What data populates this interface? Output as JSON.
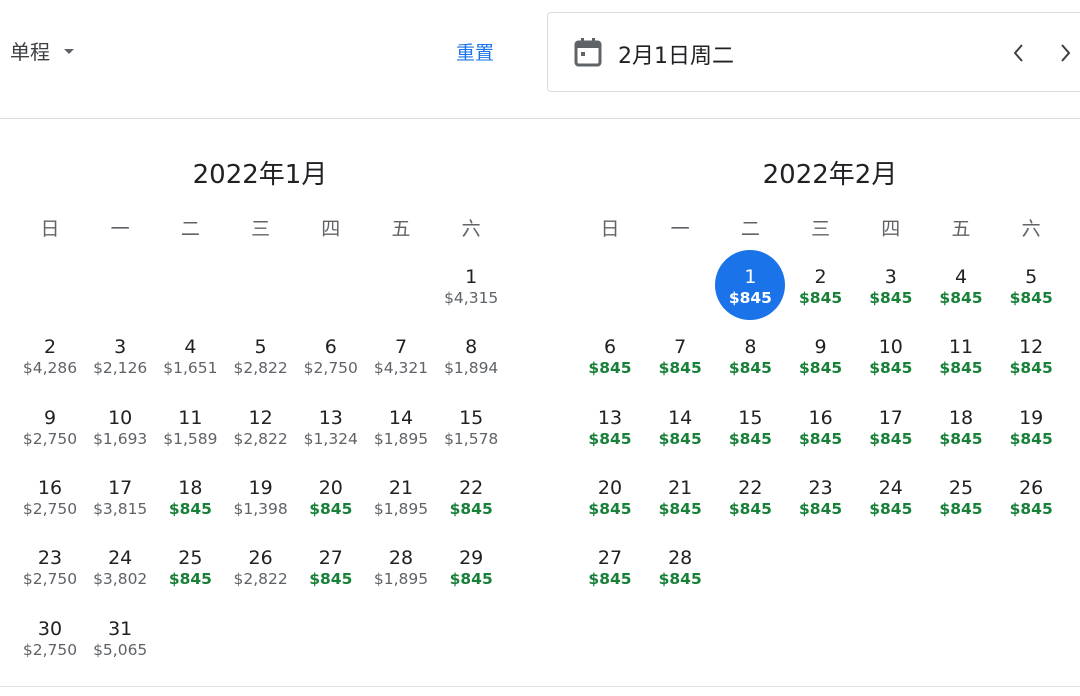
{
  "header": {
    "trip_type": "单程",
    "reset_label": "重置",
    "selected_date": "2月1日周二"
  },
  "colors": {
    "accent": "#1a73e8",
    "low_price": "#188038",
    "text": "#202124",
    "muted": "#5f6368"
  },
  "icons": [
    "chevron-down-icon",
    "calendar-icon",
    "chevron-left-icon",
    "chevron-right-icon"
  ],
  "weekdays": [
    "日",
    "一",
    "二",
    "三",
    "四",
    "五",
    "六"
  ],
  "months": [
    {
      "title": "2022年1月",
      "first_weekday": 6,
      "days": [
        {
          "d": "1",
          "p": "$4,315"
        },
        {
          "d": "2",
          "p": "$4,286"
        },
        {
          "d": "3",
          "p": "$2,126"
        },
        {
          "d": "4",
          "p": "$1,651"
        },
        {
          "d": "5",
          "p": "$2,822"
        },
        {
          "d": "6",
          "p": "$2,750"
        },
        {
          "d": "7",
          "p": "$4,321"
        },
        {
          "d": "8",
          "p": "$1,894"
        },
        {
          "d": "9",
          "p": "$2,750"
        },
        {
          "d": "10",
          "p": "$1,693"
        },
        {
          "d": "11",
          "p": "$1,589"
        },
        {
          "d": "12",
          "p": "$2,822"
        },
        {
          "d": "13",
          "p": "$1,324"
        },
        {
          "d": "14",
          "p": "$1,895"
        },
        {
          "d": "15",
          "p": "$1,578"
        },
        {
          "d": "16",
          "p": "$2,750"
        },
        {
          "d": "17",
          "p": "$3,815"
        },
        {
          "d": "18",
          "p": "$845",
          "low": true
        },
        {
          "d": "19",
          "p": "$1,398"
        },
        {
          "d": "20",
          "p": "$845",
          "low": true
        },
        {
          "d": "21",
          "p": "$1,895"
        },
        {
          "d": "22",
          "p": "$845",
          "low": true
        },
        {
          "d": "23",
          "p": "$2,750"
        },
        {
          "d": "24",
          "p": "$3,802"
        },
        {
          "d": "25",
          "p": "$845",
          "low": true
        },
        {
          "d": "26",
          "p": "$2,822"
        },
        {
          "d": "27",
          "p": "$845",
          "low": true
        },
        {
          "d": "28",
          "p": "$1,895"
        },
        {
          "d": "29",
          "p": "$845",
          "low": true
        },
        {
          "d": "30",
          "p": "$2,750"
        },
        {
          "d": "31",
          "p": "$5,065"
        }
      ]
    },
    {
      "title": "2022年2月",
      "first_weekday": 2,
      "days": [
        {
          "d": "1",
          "p": "$845",
          "low": true,
          "selected": true
        },
        {
          "d": "2",
          "p": "$845",
          "low": true
        },
        {
          "d": "3",
          "p": "$845",
          "low": true
        },
        {
          "d": "4",
          "p": "$845",
          "low": true
        },
        {
          "d": "5",
          "p": "$845",
          "low": true
        },
        {
          "d": "6",
          "p": "$845",
          "low": true
        },
        {
          "d": "7",
          "p": "$845",
          "low": true
        },
        {
          "d": "8",
          "p": "$845",
          "low": true
        },
        {
          "d": "9",
          "p": "$845",
          "low": true
        },
        {
          "d": "10",
          "p": "$845",
          "low": true
        },
        {
          "d": "11",
          "p": "$845",
          "low": true
        },
        {
          "d": "12",
          "p": "$845",
          "low": true
        },
        {
          "d": "13",
          "p": "$845",
          "low": true
        },
        {
          "d": "14",
          "p": "$845",
          "low": true
        },
        {
          "d": "15",
          "p": "$845",
          "low": true
        },
        {
          "d": "16",
          "p": "$845",
          "low": true
        },
        {
          "d": "17",
          "p": "$845",
          "low": true
        },
        {
          "d": "18",
          "p": "$845",
          "low": true
        },
        {
          "d": "19",
          "p": "$845",
          "low": true
        },
        {
          "d": "20",
          "p": "$845",
          "low": true
        },
        {
          "d": "21",
          "p": "$845",
          "low": true
        },
        {
          "d": "22",
          "p": "$845",
          "low": true
        },
        {
          "d": "23",
          "p": "$845",
          "low": true
        },
        {
          "d": "24",
          "p": "$845",
          "low": true
        },
        {
          "d": "25",
          "p": "$845",
          "low": true
        },
        {
          "d": "26",
          "p": "$845",
          "low": true
        },
        {
          "d": "27",
          "p": "$845",
          "low": true
        },
        {
          "d": "28",
          "p": "$845",
          "low": true
        }
      ]
    }
  ]
}
